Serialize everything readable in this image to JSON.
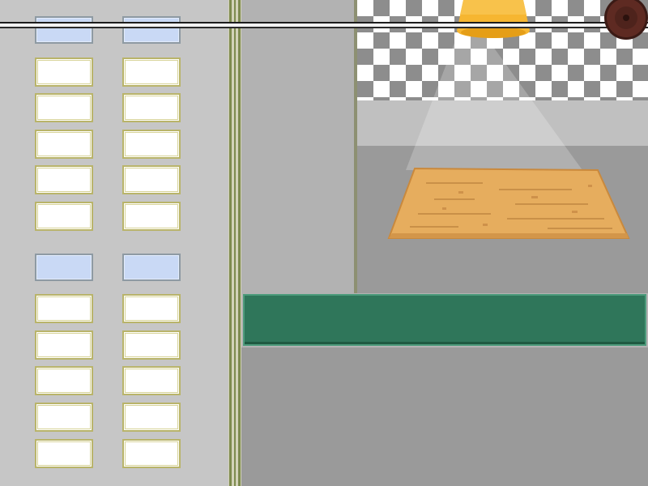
{
  "colors": {
    "panel": "#c6c6c6",
    "ticket_header": "#c9d9f5",
    "ticket_slot": "#ffffff",
    "ticket_border": "#b9b46a",
    "divider_stripe": "#7d8a4e",
    "counter": "#2f765a",
    "lamp": "#f6b631",
    "dough": "#e6ad5e",
    "knob": "#5e2a22"
  },
  "icons": {
    "lamp": "hanging-lamp-icon",
    "knob": "order-rail-knob-icon",
    "dough": "flat-dough-sheet"
  },
  "ticket_rail": {
    "groups": [
      {
        "header_slots": 2,
        "rows": 5
      },
      {
        "header_slots": 2,
        "rows": 5
      }
    ],
    "columns": 2
  }
}
